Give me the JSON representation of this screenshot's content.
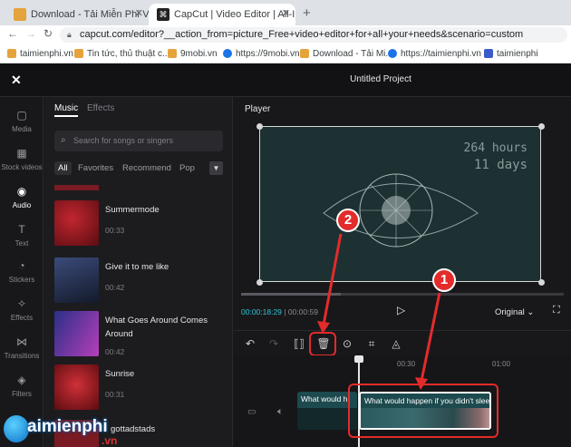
{
  "browser": {
    "tabs": [
      {
        "label": "Download - Tải Miễn Phí VN - Ph"
      },
      {
        "label": "CapCut | Video Editor | All-In-On"
      }
    ],
    "new_tab": "+",
    "url": "capcut.com/editor?__action_from=picture_Free+video+editor+for+all+your+needs&scenario=custom",
    "bookmarks": [
      {
        "label": "taimienphi.vn",
        "color": "#e5a33b"
      },
      {
        "label": "Tin tức, thủ thuật c...",
        "color": "#e5a33b"
      },
      {
        "label": "9mobi.vn",
        "color": "#e5a33b"
      },
      {
        "label": "https://9mobi.vn",
        "color": "#1a73e8"
      },
      {
        "label": "Download - Tải Mi...",
        "color": "#e5a33b"
      },
      {
        "label": "https://taimienphi.vn",
        "color": "#1a73e8"
      },
      {
        "label": "taimienphi",
        "color": "#3b5bcc"
      }
    ]
  },
  "app": {
    "project_title": "Untitled Project",
    "rail": [
      {
        "label": "Media",
        "icon": "media-icon"
      },
      {
        "label": "Stock videos",
        "icon": "stock-videos-icon"
      },
      {
        "label": "Audio",
        "icon": "audio-icon",
        "active": true
      },
      {
        "label": "Text",
        "icon": "text-icon"
      },
      {
        "label": "Stickers",
        "icon": "stickers-icon"
      },
      {
        "label": "Effects",
        "icon": "effects-icon"
      },
      {
        "label": "Transitions",
        "icon": "transitions-icon"
      },
      {
        "label": "Filters",
        "icon": "filters-icon"
      }
    ],
    "panel": {
      "tab_music": "Music",
      "tab_effects": "Effects",
      "search_placeholder": "Search for songs or singers",
      "categories": [
        "All",
        "Favorites",
        "Recommend",
        "Pop"
      ],
      "songs": [
        {
          "title": "Summermode",
          "duration": "00:33",
          "color": "#8b1b22"
        },
        {
          "title": "Give it to me like",
          "duration": "00:42",
          "color": "#27324a"
        },
        {
          "title": "What Goes Around Comes Around",
          "duration": "00:42",
          "color": "#6b2f8e"
        },
        {
          "title": "Sunrise",
          "duration": "00:31",
          "color": "#9e2029"
        },
        {
          "title": "gottadstads",
          "duration": "",
          "color": "#7a1a22"
        }
      ]
    },
    "player": {
      "label": "Player",
      "overlay_line1": "264 hours",
      "overlay_line2": "11 days",
      "current_time": "00:00:18:29",
      "total_time": "00:00:59",
      "ratio": "Original",
      "progress": 0.31
    },
    "timeline": {
      "ruler": [
        "00:30",
        "01:00"
      ],
      "clip_left_label": "What would h",
      "clip_main_label": "What would happen if you didn't slee"
    },
    "annotations": {
      "one": "1",
      "two": "2"
    },
    "watermark": {
      "text": "aimienphi",
      "suffix": ".vn"
    }
  }
}
